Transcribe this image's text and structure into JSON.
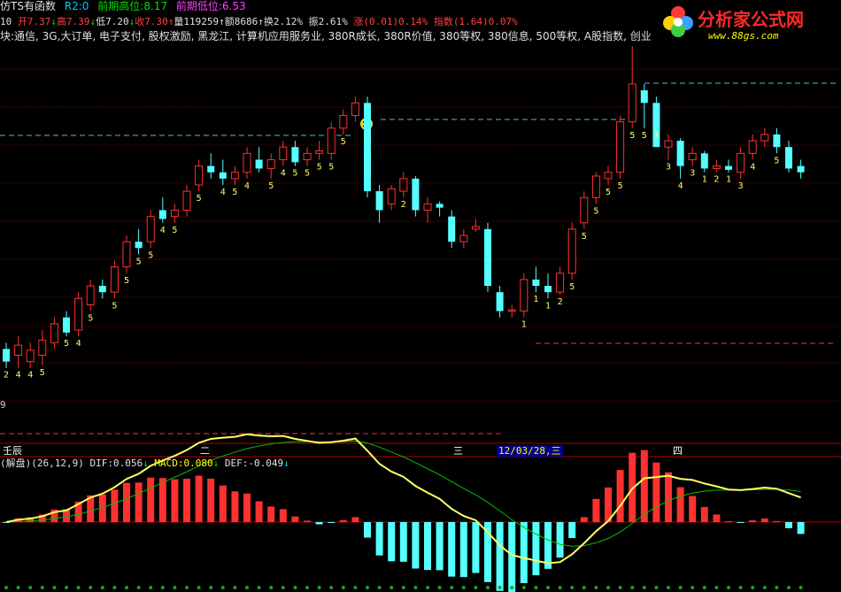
{
  "header": {
    "formula": "仿TS有函数",
    "r2": "R2:0",
    "prev_high_label": "前期高位:",
    "prev_high_value": "8.17",
    "prev_low_label": "前期低位:",
    "prev_low_value": "6.53"
  },
  "quote": {
    "period": "10",
    "open": "开7.37",
    "high": "高7.39",
    "low": "低7.20",
    "close": "收7.30",
    "volume": "量119259",
    "amount": "额8686",
    "turnover": "换2.12%",
    "amplitude": "振2.61%",
    "change": "涨(0.01)0.14%",
    "index": "指数(1.64)0.07%"
  },
  "sectors": "块:通信, 3G,大订单, 电子支付, 股权激励, 黑龙江, 计算机应用服务业, 380R成长, 380R价值, 380等权, 380信息, 500等权, A股指数, 创业",
  "logo": {
    "title": "分析家公式网",
    "url": "www.88gs.com"
  },
  "axis": {
    "label1": "壬辰",
    "label2": "二",
    "label3": "三",
    "date": "12/03/28,三",
    "label4": "四",
    "left_edge": "9"
  },
  "indicator": {
    "name": "(解盘)",
    "params": "(26,12,9)",
    "dif_label": "DIF:",
    "dif_value": "0.056",
    "macd_label": "MACD:",
    "macd_value": "0.080",
    "def_label": "DEF:",
    "def_value": "-0.049"
  },
  "colors": {
    "up": "#ff3030",
    "down": "#54ffff",
    "dif": "#ffff60",
    "dea": "#00c000"
  },
  "chart_data": {
    "type": "candlestick",
    "candles": [
      {
        "o": 8.55,
        "h": 8.6,
        "l": 8.4,
        "c": 8.45,
        "lab": "2"
      },
      {
        "o": 8.5,
        "h": 8.65,
        "l": 8.4,
        "c": 8.58,
        "lab": "4"
      },
      {
        "o": 8.45,
        "h": 8.6,
        "l": 8.4,
        "c": 8.54,
        "lab": "4"
      },
      {
        "o": 8.5,
        "h": 8.7,
        "l": 8.42,
        "c": 8.62,
        "lab": "5"
      },
      {
        "o": 8.6,
        "h": 8.8,
        "l": 8.55,
        "c": 8.75,
        "lab": ""
      },
      {
        "o": 8.8,
        "h": 8.85,
        "l": 8.65,
        "c": 8.68,
        "lab": "5"
      },
      {
        "o": 8.7,
        "h": 9.0,
        "l": 8.65,
        "c": 8.95,
        "lab": "4"
      },
      {
        "o": 8.9,
        "h": 9.1,
        "l": 8.85,
        "c": 9.05,
        "lab": "5"
      },
      {
        "o": 9.05,
        "h": 9.1,
        "l": 8.95,
        "c": 9.0,
        "lab": ""
      },
      {
        "o": 9.0,
        "h": 9.25,
        "l": 8.95,
        "c": 9.2,
        "lab": "5"
      },
      {
        "o": 9.2,
        "h": 9.45,
        "l": 9.15,
        "c": 9.4,
        "lab": "5"
      },
      {
        "o": 9.4,
        "h": 9.5,
        "l": 9.3,
        "c": 9.35,
        "lab": "5"
      },
      {
        "o": 9.4,
        "h": 9.65,
        "l": 9.35,
        "c": 9.6,
        "lab": "5"
      },
      {
        "o": 9.65,
        "h": 9.75,
        "l": 9.55,
        "c": 9.58,
        "lab": "4"
      },
      {
        "o": 9.6,
        "h": 9.7,
        "l": 9.55,
        "c": 9.65,
        "lab": "5"
      },
      {
        "o": 9.65,
        "h": 9.85,
        "l": 9.6,
        "c": 9.8,
        "lab": ""
      },
      {
        "o": 9.85,
        "h": 10.05,
        "l": 9.8,
        "c": 10.0,
        "lab": "5"
      },
      {
        "o": 10.0,
        "h": 10.1,
        "l": 9.9,
        "c": 9.95,
        "lab": ""
      },
      {
        "o": 9.95,
        "h": 10.05,
        "l": 9.85,
        "c": 9.9,
        "lab": "4"
      },
      {
        "o": 9.9,
        "h": 10.0,
        "l": 9.85,
        "c": 9.95,
        "lab": "5"
      },
      {
        "o": 9.95,
        "h": 10.15,
        "l": 9.9,
        "c": 10.1,
        "lab": "4"
      },
      {
        "o": 10.05,
        "h": 10.15,
        "l": 9.95,
        "c": 9.98,
        "lab": ""
      },
      {
        "o": 9.98,
        "h": 10.1,
        "l": 9.9,
        "c": 10.05,
        "lab": "5"
      },
      {
        "o": 10.05,
        "h": 10.2,
        "l": 10.0,
        "c": 10.15,
        "lab": "4"
      },
      {
        "o": 10.15,
        "h": 10.2,
        "l": 10.0,
        "c": 10.03,
        "lab": "5"
      },
      {
        "o": 10.05,
        "h": 10.15,
        "l": 10.0,
        "c": 10.1,
        "lab": "5"
      },
      {
        "o": 10.1,
        "h": 10.2,
        "l": 10.05,
        "c": 10.12,
        "lab": "5"
      },
      {
        "o": 10.1,
        "h": 10.35,
        "l": 10.05,
        "c": 10.3,
        "lab": "5"
      },
      {
        "o": 10.3,
        "h": 10.45,
        "l": 10.25,
        "c": 10.4,
        "lab": "5"
      },
      {
        "o": 10.4,
        "h": 10.55,
        "l": 10.35,
        "c": 10.5,
        "lab": ""
      },
      {
        "o": 10.5,
        "h": 10.55,
        "l": 9.75,
        "c": 9.8,
        "lab": ""
      },
      {
        "o": 9.8,
        "h": 9.85,
        "l": 9.55,
        "c": 9.65,
        "lab": ""
      },
      {
        "o": 9.7,
        "h": 9.85,
        "l": 9.65,
        "c": 9.82,
        "lab": ""
      },
      {
        "o": 9.8,
        "h": 9.95,
        "l": 9.75,
        "c": 9.9,
        "lab": "2"
      },
      {
        "o": 9.9,
        "h": 9.92,
        "l": 9.6,
        "c": 9.65,
        "lab": ""
      },
      {
        "o": 9.65,
        "h": 9.75,
        "l": 9.55,
        "c": 9.7,
        "lab": ""
      },
      {
        "o": 9.7,
        "h": 9.72,
        "l": 9.6,
        "c": 9.67,
        "lab": ""
      },
      {
        "o": 9.6,
        "h": 9.65,
        "l": 9.35,
        "c": 9.4,
        "lab": ""
      },
      {
        "o": 9.4,
        "h": 9.5,
        "l": 9.35,
        "c": 9.45,
        "lab": ""
      },
      {
        "o": 9.5,
        "h": 9.58,
        "l": 9.48,
        "c": 9.52,
        "lab": ""
      },
      {
        "o": 9.5,
        "h": 9.55,
        "l": 9.0,
        "c": 9.05,
        "lab": ""
      },
      {
        "o": 9.0,
        "h": 9.05,
        "l": 8.8,
        "c": 8.85,
        "lab": ""
      },
      {
        "o": 8.85,
        "h": 8.9,
        "l": 8.8,
        "c": 8.86,
        "lab": ""
      },
      {
        "o": 8.85,
        "h": 9.15,
        "l": 8.8,
        "c": 9.1,
        "lab": "1"
      },
      {
        "o": 9.1,
        "h": 9.2,
        "l": 9.0,
        "c": 9.05,
        "lab": "1"
      },
      {
        "o": 9.05,
        "h": 9.15,
        "l": 8.95,
        "c": 9.0,
        "lab": "1"
      },
      {
        "o": 9.0,
        "h": 9.2,
        "l": 8.98,
        "c": 9.15,
        "lab": "2"
      },
      {
        "o": 9.15,
        "h": 9.55,
        "l": 9.1,
        "c": 9.5,
        "lab": "5"
      },
      {
        "o": 9.55,
        "h": 9.8,
        "l": 9.5,
        "c": 9.75,
        "lab": "5"
      },
      {
        "o": 9.75,
        "h": 9.95,
        "l": 9.7,
        "c": 9.92,
        "lab": "5"
      },
      {
        "o": 9.9,
        "h": 10.0,
        "l": 9.85,
        "c": 9.95,
        "lab": "5"
      },
      {
        "o": 9.95,
        "h": 10.4,
        "l": 9.9,
        "c": 10.35,
        "lab": "5"
      },
      {
        "o": 10.35,
        "h": 10.95,
        "l": 10.3,
        "c": 10.65,
        "lab": "5"
      },
      {
        "o": 10.6,
        "h": 10.65,
        "l": 10.3,
        "c": 10.5,
        "lab": "5"
      },
      {
        "o": 10.5,
        "h": 10.55,
        "l": 10.3,
        "c": 10.15,
        "lab": "3"
      },
      {
        "o": 10.15,
        "h": 10.25,
        "l": 10.05,
        "c": 10.2,
        "lab": "3"
      },
      {
        "o": 10.2,
        "h": 10.22,
        "l": 9.9,
        "c": 10.0,
        "lab": "4"
      },
      {
        "o": 10.05,
        "h": 10.15,
        "l": 10.0,
        "c": 10.1,
        "lab": "3"
      },
      {
        "o": 10.1,
        "h": 10.12,
        "l": 9.95,
        "c": 9.98,
        "lab": "1"
      },
      {
        "o": 9.98,
        "h": 10.05,
        "l": 9.95,
        "c": 10.0,
        "lab": "2"
      },
      {
        "o": 10.0,
        "h": 10.05,
        "l": 9.95,
        "c": 9.97,
        "lab": "1"
      },
      {
        "o": 9.95,
        "h": 10.15,
        "l": 9.9,
        "c": 10.1,
        "lab": "3"
      },
      {
        "o": 10.1,
        "h": 10.25,
        "l": 10.05,
        "c": 10.2,
        "lab": "4"
      },
      {
        "o": 10.2,
        "h": 10.3,
        "l": 10.15,
        "c": 10.25,
        "lab": ""
      },
      {
        "o": 10.25,
        "h": 10.3,
        "l": 10.1,
        "c": 10.15,
        "lab": "5"
      },
      {
        "o": 10.15,
        "h": 10.2,
        "l": 9.95,
        "c": 9.98,
        "lab": ""
      },
      {
        "o": 10.0,
        "h": 10.05,
        "l": 9.9,
        "c": 9.95,
        "lab": ""
      }
    ]
  }
}
